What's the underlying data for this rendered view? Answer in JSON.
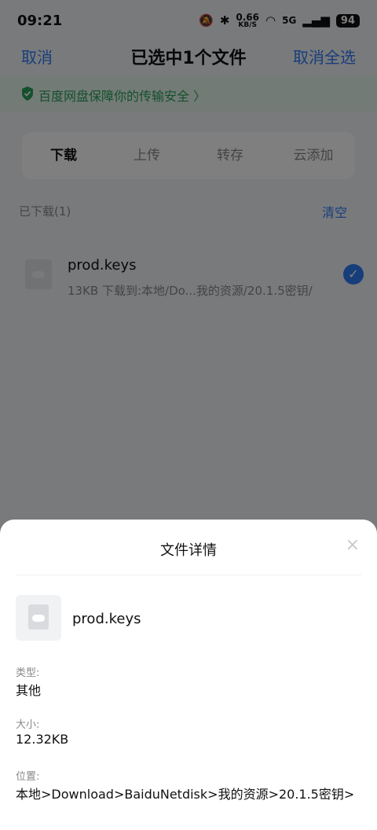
{
  "status_bar": {
    "time": "09:21",
    "net_speed_value": "0.66",
    "net_speed_unit": "KB/S",
    "network": "5G",
    "battery": "94",
    "icons": [
      "bell-off-icon",
      "bluetooth-icon",
      "wifi-icon",
      "cellular-signal-icon"
    ]
  },
  "header": {
    "cancel_label": "取消",
    "title": "已选中1个文件",
    "deselect_all_label": "取消全选"
  },
  "banner": {
    "text": "百度网盘保障你的传输安全 〉"
  },
  "tabs": [
    {
      "label": "下载",
      "active": true
    },
    {
      "label": "上传",
      "active": false
    },
    {
      "label": "转存",
      "active": false
    },
    {
      "label": "云添加",
      "active": false
    }
  ],
  "list": {
    "section_label": "已下载(1)",
    "clear_label": "清空",
    "items": [
      {
        "name": "prod.keys",
        "meta": "13KB 下载到:本地/Do...我的资源/20.1.5密钥/",
        "checked": true
      }
    ]
  },
  "sheet": {
    "title": "文件详情",
    "close_glyph": "×",
    "file_name": "prod.keys",
    "type_label": "类型:",
    "type_value": "其他",
    "size_label": "大小:",
    "size_value": "12.32KB",
    "location_label": "位置:",
    "location_value": "本地>Download>BaiduNetdisk>我的资源>20.1.5密钥>"
  },
  "colors": {
    "accent": "#2f7cf6",
    "secure_green": "#2aa05a",
    "overlay": "rgba(0,0,0,0.50)"
  }
}
